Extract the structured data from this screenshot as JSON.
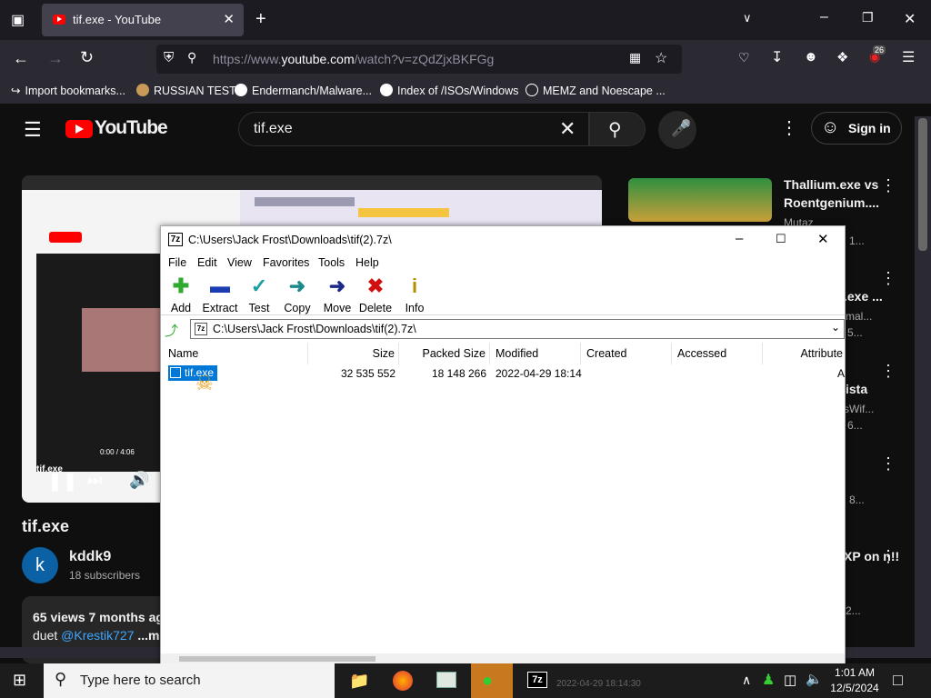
{
  "browser": {
    "tab_title": "tif.exe - YouTube",
    "url_prefix": "https://www.",
    "url_domain": "youtube.com",
    "url_rest": "/watch?v=zQdZjxBKFGg",
    "badge_count": "26",
    "bookmarks": [
      {
        "label": "Import bookmarks..."
      },
      {
        "label": "RUSSIAN TEST"
      },
      {
        "label": "Endermanch/Malware..."
      },
      {
        "label": "Index of /ISOs/Windows"
      },
      {
        "label": "MEMZ and Noescape ..."
      }
    ]
  },
  "youtube": {
    "logo_text": "YouTube",
    "search_value": "tif.exe",
    "sign_in": "Sign in",
    "video_title": "tif.exe",
    "channel_name": "kddk9",
    "channel_initial": "k",
    "subscribers": "18 subscribers",
    "desc_line1": "65 views  7 months ag",
    "desc_line2_prefix": "duet ",
    "desc_link": "@Krestik727",
    "desc_more": " ...m",
    "video_overlay_label": "tif.exe",
    "video_inner_time": "0:00 / 4:06",
    "recommendations": [
      {
        "title": "Thallium.exe vs Roentgenium....",
        "meta1": "Mutaz",
        "meta2": "1..."
      },
      {
        "title": ".exe ...",
        "meta1": "mal...",
        "meta2": "5..."
      },
      {
        "title": "ista",
        "meta1": "sWif...",
        "meta2": "6..."
      },
      {
        "title": "",
        "meta1": "8...",
        "meta2": ""
      },
      {
        "title": "XP on n!!",
        "meta1": "2...",
        "meta2": ""
      }
    ]
  },
  "zip": {
    "title": "C:\\Users\\Jack Frost\\Downloads\\tif(2).7z\\",
    "menu": [
      "File",
      "Edit",
      "View",
      "Favorites",
      "Tools",
      "Help"
    ],
    "toolbar": [
      {
        "label": "Add",
        "icon": "plus-icon",
        "color": "#2faa2f"
      },
      {
        "label": "Extract",
        "icon": "minus-icon",
        "color": "#1a3cb0"
      },
      {
        "label": "Test",
        "icon": "check-icon",
        "color": "#1aa0a0"
      },
      {
        "label": "Copy",
        "icon": "arrow-right-icon",
        "color": "#1a8a8a"
      },
      {
        "label": "Move",
        "icon": "arrow-right-icon",
        "color": "#1a2a8a"
      },
      {
        "label": "Delete",
        "icon": "x-icon",
        "color": "#d01010"
      },
      {
        "label": "Info",
        "icon": "info-icon",
        "color": "#b09000"
      }
    ],
    "address": "C:\\Users\\Jack Frost\\Downloads\\tif(2).7z\\",
    "columns": [
      "Name",
      "Size",
      "Packed Size",
      "Modified",
      "Created",
      "Accessed",
      "Attribute"
    ],
    "files": [
      {
        "name": "tif.exe",
        "size": "32 535 552",
        "packed": "18 148 266",
        "modified": "2022-04-29 18:14",
        "attr": "A"
      }
    ]
  },
  "taskbar": {
    "search_placeholder": "Type here to search",
    "behind_text": "2022-04-29 18:14:30",
    "time": "1:01 AM",
    "date": "12/5/2024"
  }
}
